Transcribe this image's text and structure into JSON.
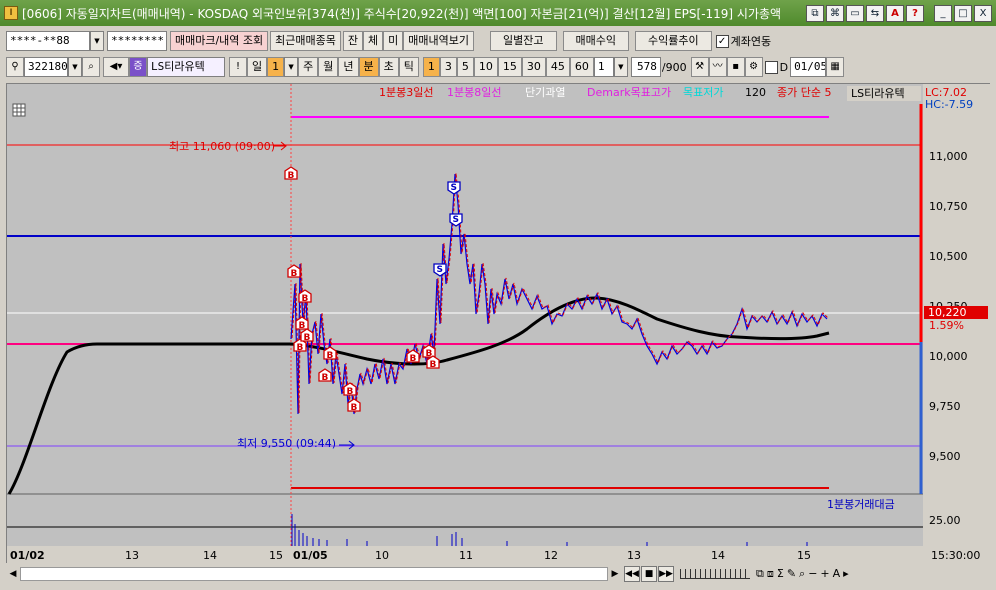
{
  "window": {
    "app_icon": "I",
    "title": "[0606] 자동일지차트(매매내역) - KOSDAQ 외국인보유[374(천)] 주식수[20,922(천)] 액면[100] 자본금[21(억)] 결산[12월] EPS[-119] 시가총액",
    "buttons": [
      "⧉",
      "⌘",
      "▭",
      "⇆",
      "A",
      "?",
      "_",
      "□",
      "X"
    ]
  },
  "toolbar1": {
    "account": "****-**88",
    "password": "********",
    "trade_mark_btn": "매매마크/내역 조회",
    "recent_stocks_btn": "최근매매종목",
    "tabs": [
      "잔",
      "체",
      "미"
    ],
    "trade_history_btn": "매매내역보기",
    "daily_balance_btn": "일별잔고",
    "trade_profit_btn": "매매수익",
    "return_trend_btn": "수익률추이",
    "account_link_check": "✓",
    "account_link_label": "계좌연동"
  },
  "toolbar2": {
    "code": "322180",
    "stock_name": "LS티라유텍",
    "period_tabs": [
      "일",
      "1",
      "주",
      "월",
      "년",
      "분",
      "초",
      "틱"
    ],
    "interval_buttons": [
      "1",
      "3",
      "5",
      "10",
      "15",
      "30",
      "45",
      "60"
    ],
    "active_interval": "1",
    "interval_value": "1",
    "count": "578",
    "count_total": "/900",
    "d_label": "D",
    "date": "01/05"
  },
  "legend": {
    "items": [
      {
        "label": "1분봉3일선",
        "color": "#e00000"
      },
      {
        "label": "1분봉8일선",
        "color": "#e020e0"
      },
      {
        "label": "단기과열",
        "color": "#ffffff"
      },
      {
        "label": "Demark목표고가",
        "color": "#e020e0"
      },
      {
        "label": "목표저가",
        "color": "#00d8d8"
      },
      {
        "label": "120",
        "color": "#000000"
      },
      {
        "label": "종가 단순 5",
        "color": "#e00000"
      }
    ],
    "stock_tag": "LS티라유텍",
    "lc": "LC:7.02",
    "hc": "HC:-7.59",
    "lower_legend": "1분봉거래대금"
  },
  "annotations": {
    "high": "최고 11,060 (09:00)",
    "low": "최저 9,550 (09:44)",
    "current_price": "10,220",
    "change_pct": "1.59%"
  },
  "y_axis": {
    "labels": [
      "11,000",
      "10,750",
      "10,500",
      "10,250",
      "10,000",
      "9,750",
      "9,500"
    ],
    "volume_label": "25.00"
  },
  "x_axis": {
    "labels": [
      "01/02",
      "13",
      "14",
      "15",
      "01/05",
      "10",
      "11",
      "12",
      "13",
      "14",
      "15"
    ],
    "time_label": "15:30:00"
  },
  "markers": {
    "buy": "B",
    "sell": "S"
  },
  "colors": {
    "chart_bg": "#c0c0c0",
    "price_up": "#e00000",
    "price_down": "#0000e0",
    "ma120": "#000000",
    "high_line": "#ff0000",
    "target_line": "#0000c8",
    "base_line": "#ff0080",
    "magenta": "#ff00ff",
    "purple": "#8040ff"
  },
  "icons": {
    "search": "search-icon",
    "speaker": "speaker-icon",
    "exclaim": "exclamation-icon",
    "settings": "gear-icon",
    "save": "save-icon",
    "calendar": "calendar-icon"
  }
}
